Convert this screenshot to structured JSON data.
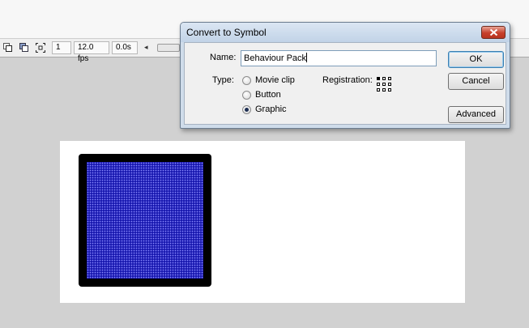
{
  "toolbar": {
    "frame": "1",
    "fps": "12.0 fps",
    "time": "0.0s",
    "icons": [
      "onion-skin-icon",
      "onion-skin-outlines-icon",
      "edit-multiple-frames-icon"
    ],
    "scroll_left_glyph": "◂"
  },
  "dialog": {
    "title": "Convert to Symbol",
    "close_icon": "close-icon",
    "name_label": "Name:",
    "name_value": "Behaviour Pack",
    "type_label": "Type:",
    "types": [
      {
        "label": "Movie clip",
        "checked": false
      },
      {
        "label": "Button",
        "checked": false
      },
      {
        "label": "Graphic",
        "checked": true
      }
    ],
    "registration_label": "Registration:",
    "registration_point": "top-left",
    "ok_label": "OK",
    "cancel_label": "Cancel",
    "advanced_label": "Advanced"
  },
  "stage": {
    "shape_border_color": "#000000",
    "shape_fill_color": "#1a1ab0"
  },
  "colors": {
    "workspace": "#d1d1d1",
    "stage": "#ffffff",
    "close_button": "#c7402b"
  }
}
